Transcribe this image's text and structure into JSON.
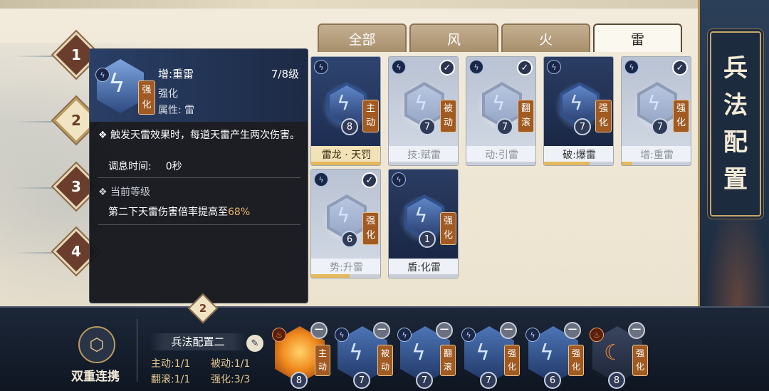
{
  "title": {
    "chars": [
      "兵",
      "法",
      "配",
      "置"
    ]
  },
  "levels": [
    {
      "n": "1"
    },
    {
      "n": "2"
    },
    {
      "n": "3"
    },
    {
      "n": "4"
    }
  ],
  "tabs": [
    {
      "label": "全部"
    },
    {
      "label": "风"
    },
    {
      "label": "火"
    },
    {
      "label": "雷"
    }
  ],
  "cards": [
    {
      "name": "雷龙 · 天罚",
      "level": "8",
      "tag": "主动",
      "checked": false,
      "faded": false,
      "progress": 1.0
    },
    {
      "name": "技:赋雷",
      "level": "7",
      "tag": "被动",
      "checked": true,
      "faded": true,
      "progress": 0.0
    },
    {
      "name": "动:引雷",
      "level": "7",
      "tag": "翻滚",
      "checked": true,
      "faded": true,
      "progress": 0.0
    },
    {
      "name": "破:爆雷",
      "level": "7",
      "tag": "强化",
      "checked": false,
      "faded": false,
      "progress": 0.65
    },
    {
      "name": "增:重雷",
      "level": "7",
      "tag": "强化",
      "checked": true,
      "faded": true,
      "progress": 0.15
    },
    {
      "name": "势:升雷",
      "level": "6",
      "tag": "强化",
      "checked": true,
      "faded": true,
      "progress": 0.55
    },
    {
      "name": "盾:化雷",
      "level": "1",
      "tag": "强化",
      "checked": false,
      "faded": false,
      "progress": 0.0
    }
  ],
  "tooltip": {
    "name": "增:重雷",
    "level": "7/8级",
    "tag": "强化",
    "sub": "强化",
    "attr": "属性: 雷",
    "effect": "触发天雷效果时，每道天雷产生两次伤害。",
    "cooldown_label": "调息时间:",
    "cooldown_value": "0秒",
    "section": "当前等级",
    "now_text": "第二下天雷伤害倍率提高至",
    "now_value": "68%"
  },
  "bottom": {
    "dual_label": "双重连携",
    "config_num": "2",
    "config_name": "兵法配置二",
    "stats": [
      "主动:1/1",
      "被动:1/1",
      "翻滚:1/1",
      "强化:3/3"
    ],
    "slots": [
      {
        "level": "8",
        "tag": "主动",
        "style": "fire"
      },
      {
        "level": "7",
        "tag": "被动",
        "style": "blue"
      },
      {
        "level": "7",
        "tag": "翻滚",
        "style": "blue"
      },
      {
        "level": "7",
        "tag": "强化",
        "style": "blue"
      },
      {
        "level": "6",
        "tag": "强化",
        "style": "blue"
      },
      {
        "level": "8",
        "tag": "强化",
        "style": "firedark"
      }
    ]
  },
  "colors": {
    "accent": "#a05a22",
    "highlight": "#e7b46a",
    "panel": "#1c2738"
  },
  "icons": {
    "type": "lightning-icon",
    "check": "check-icon",
    "minus": "minus-icon",
    "edit": "brush-icon"
  }
}
